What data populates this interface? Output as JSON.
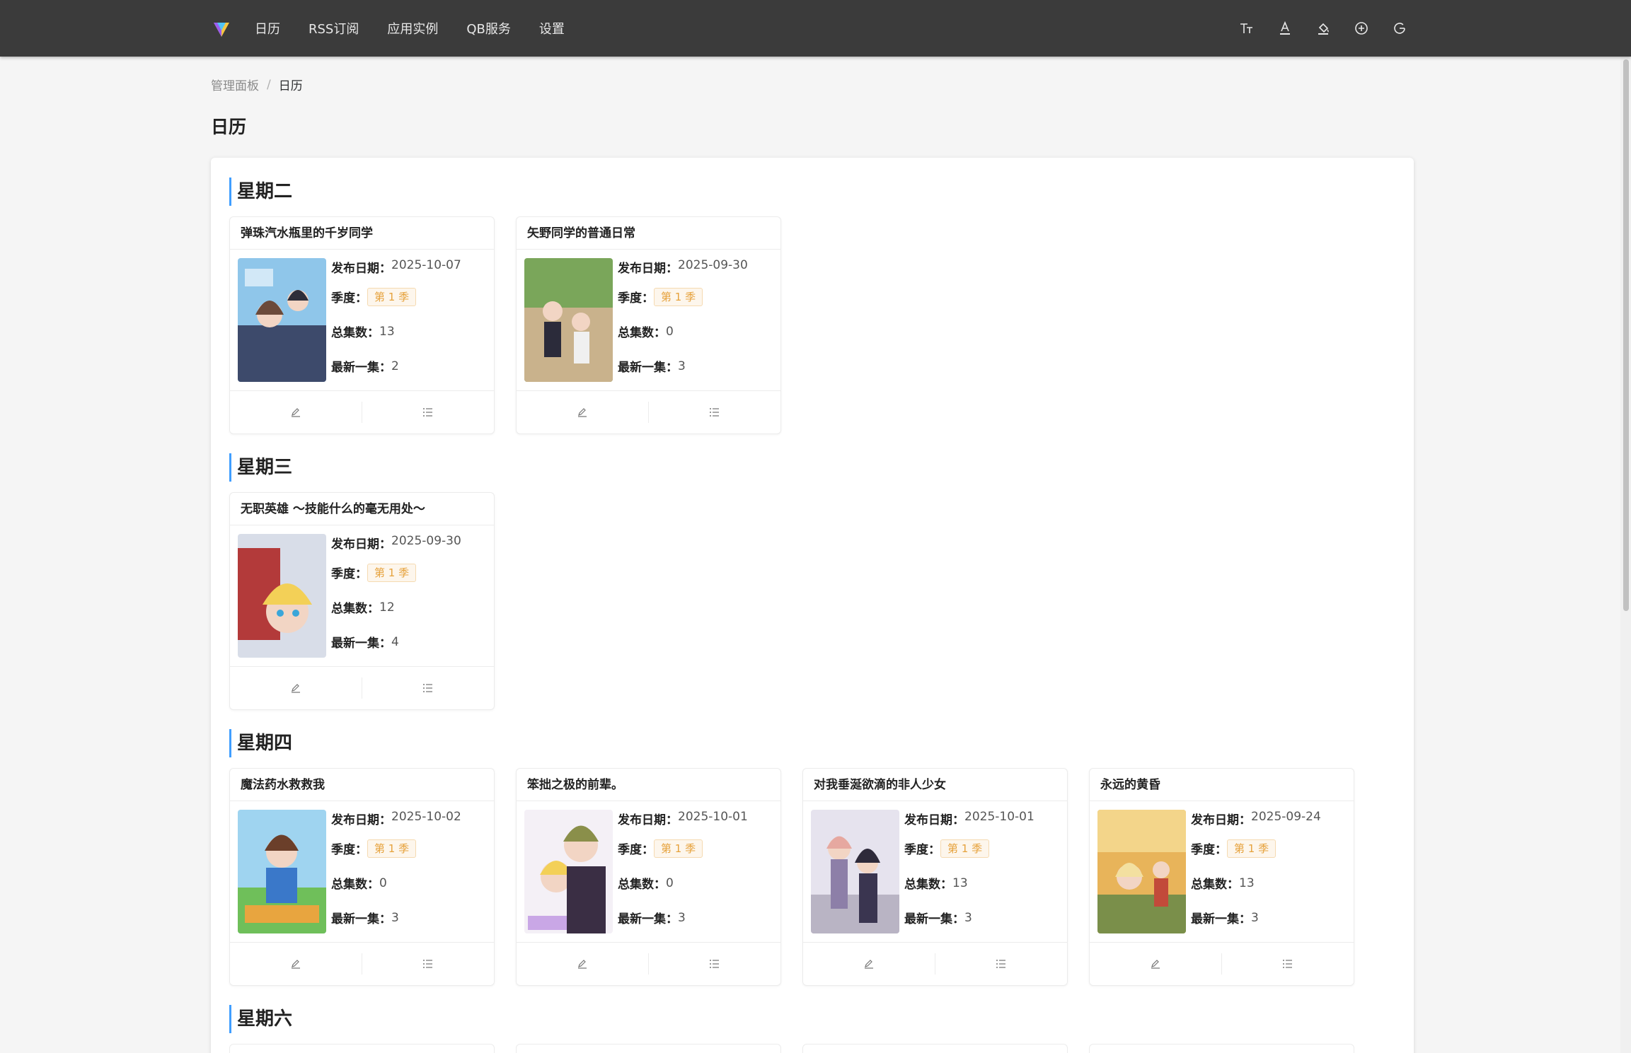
{
  "nav": {
    "items": [
      {
        "label": "日历"
      },
      {
        "label": "RSS订阅"
      },
      {
        "label": "应用实例"
      },
      {
        "label": "QB服务"
      },
      {
        "label": "设置"
      }
    ],
    "tools": [
      "font-size-icon",
      "text-color-icon",
      "fill-color-icon",
      "add-circle-icon",
      "refresh-icon"
    ]
  },
  "breadcrumb": {
    "root": "管理面板",
    "separator": "/",
    "current": "日历"
  },
  "page": {
    "title": "日历"
  },
  "labels": {
    "release_date": "发布日期：",
    "season": "季度：",
    "total_episodes": "总集数：",
    "latest_episode": "最新一集："
  },
  "colors": {
    "accent": "#409eff",
    "tag_bg": "#fdf6ec",
    "tag_border": "#f5dab1",
    "tag_text": "#e6a23c",
    "header_bg": "#3b3b3b"
  },
  "days": [
    {
      "name": "星期二",
      "shows": [
        {
          "title": "弹珠汽水瓶里的千岁同学",
          "release_date": "2025-10-07",
          "season": "第 1 季",
          "total_episodes": "13",
          "latest_episode": "2"
        },
        {
          "title": "矢野同学的普通日常",
          "release_date": "2025-09-30",
          "season": "第 1 季",
          "total_episodes": "0",
          "latest_episode": "3"
        }
      ]
    },
    {
      "name": "星期三",
      "shows": [
        {
          "title": "无职英雄 ～技能什么的毫无用处～",
          "release_date": "2025-09-30",
          "season": "第 1 季",
          "total_episodes": "12",
          "latest_episode": "4"
        }
      ]
    },
    {
      "name": "星期四",
      "shows": [
        {
          "title": "魔法药水救救我",
          "release_date": "2025-10-02",
          "season": "第 1 季",
          "total_episodes": "0",
          "latest_episode": "3"
        },
        {
          "title": "笨拙之极的前辈。",
          "release_date": "2025-10-01",
          "season": "第 1 季",
          "total_episodes": "0",
          "latest_episode": "3"
        },
        {
          "title": "对我垂涎欲滴的非人少女",
          "release_date": "2025-10-01",
          "season": "第 1 季",
          "total_episodes": "13",
          "latest_episode": "3"
        },
        {
          "title": "永远的黄昏",
          "release_date": "2025-09-24",
          "season": "第 1 季",
          "total_episodes": "13",
          "latest_episode": "3"
        }
      ]
    },
    {
      "name": "星期六",
      "shows": []
    }
  ]
}
